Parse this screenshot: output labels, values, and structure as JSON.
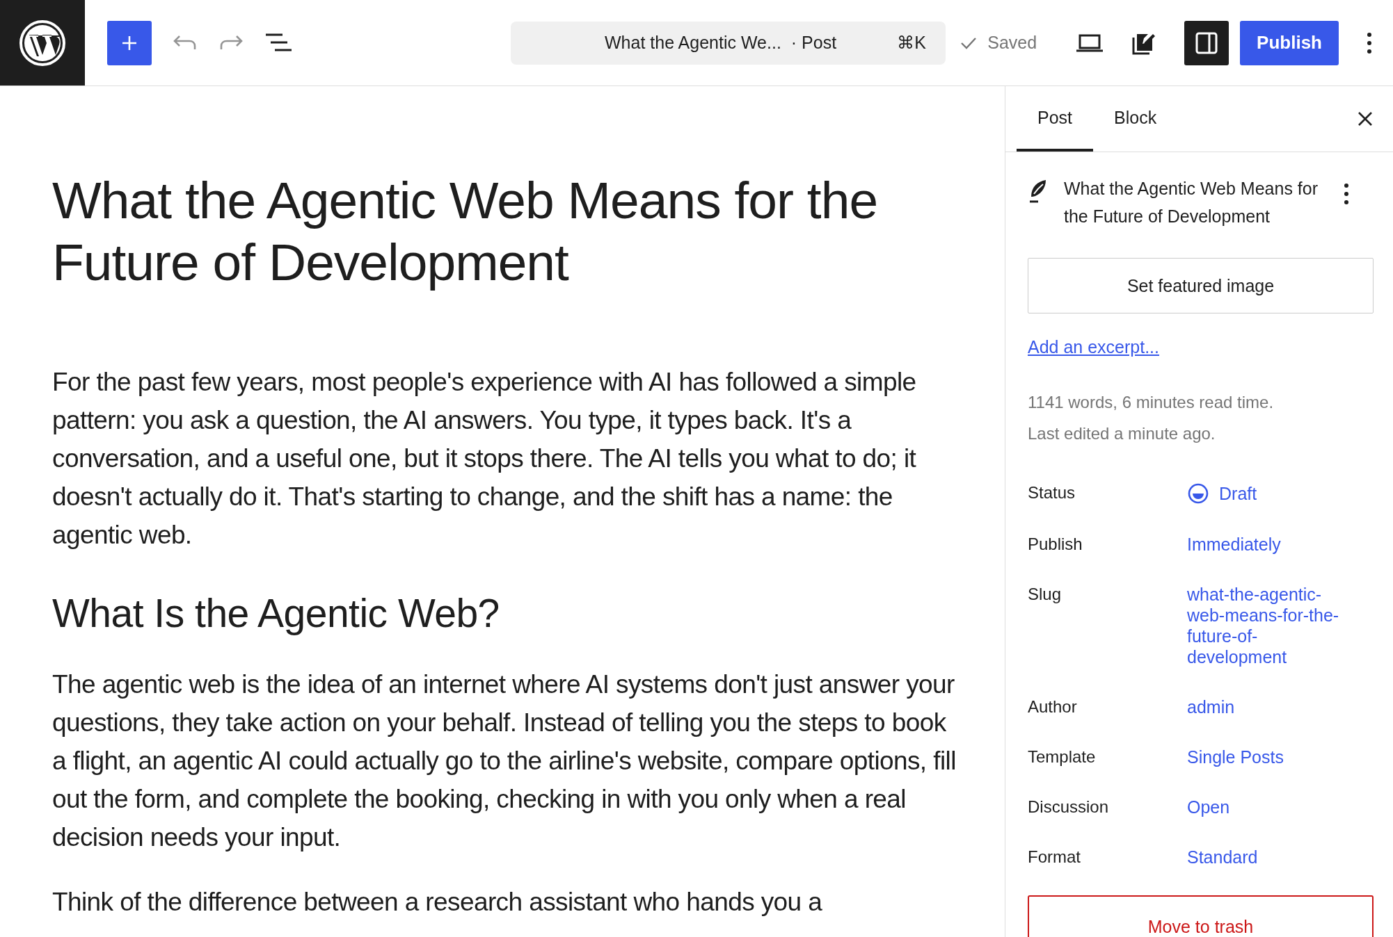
{
  "toolbar": {
    "add_selected": true,
    "document_title": "What the Agentic We...",
    "document_type": "· Post",
    "shortcut": "⌘K",
    "save_state": "Saved",
    "settings_panel_open": true,
    "publish_label": "Publish"
  },
  "editor": {
    "title": "What the Agentic Web Means for the Future of Development",
    "blocks": [
      {
        "kind": "paragraph",
        "text": "For the past few years, most people's experience with AI has followed a simple pattern: you ask a question, the AI answers. You type, it types back. It's a conversation, and a useful one, but it stops there. The AI tells you what to do; it doesn't actually do it. That's starting to change, and the shift has a name: the agentic web."
      },
      {
        "kind": "heading",
        "text": "What Is the Agentic Web?"
      },
      {
        "kind": "paragraph",
        "text": "The agentic web is the idea of an internet where AI systems don't just answer your questions, they take action on your behalf. Instead of telling you the steps to book a flight, an agentic AI could actually go to the airline's website, compare options, fill out the form, and complete the booking, checking in with you only when a real decision needs your input."
      },
      {
        "kind": "paragraph",
        "text": "Think of the difference between a research assistant who hands you a"
      }
    ]
  },
  "sidebar": {
    "tabs": [
      {
        "label": "Post",
        "selected": true
      },
      {
        "label": "Block",
        "selected": false
      }
    ],
    "post_title": "What the Agentic Web Means for the Future of Development",
    "featured_image_button": "Set featured image",
    "excerpt_link": "Add an excerpt...",
    "stats": "1141 words, 6 minutes read time.",
    "last_edited": "Last edited a minute ago.",
    "fields": [
      {
        "kind": "status",
        "label": "Status",
        "value": "Draft"
      },
      {
        "kind": "link",
        "label": "Publish",
        "value": "Immediately"
      },
      {
        "kind": "link",
        "label": "Slug",
        "value": "what-the-agentic-web-means-for-the-future-of-development"
      },
      {
        "kind": "link",
        "label": "Author",
        "value": "admin"
      },
      {
        "kind": "link",
        "label": "Template",
        "value": "Single Posts"
      },
      {
        "kind": "link",
        "label": "Discussion",
        "value": "Open"
      },
      {
        "kind": "link",
        "label": "Format",
        "value": "Standard"
      }
    ],
    "trash_button": "Move to trash"
  }
}
